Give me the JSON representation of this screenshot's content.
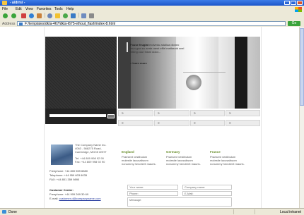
{
  "window": {
    "title": "- a/drrsi -",
    "brand_colors": {
      "title_bar": "#2a66d9",
      "accent_green": "#6a8f2e"
    }
  },
  "menu": [
    "File",
    "Edit",
    "View",
    "Favorites",
    "Tools",
    "Help"
  ],
  "toolbar": {
    "icons": [
      "back-icon",
      "forward-icon",
      "stop-icon",
      "refresh-icon",
      "home-icon",
      "search-icon",
      "favorites-icon",
      "media-icon",
      "history-icon",
      "mail-icon",
      "print-icon"
    ]
  },
  "address": {
    "label": "Address",
    "value": "F:/templates/dkta-467/dkta-t675-ethout_flash/index-8.html",
    "go": "Go"
  },
  "hero": {
    "text_bold": "Fouse feugiat",
    "text": "molvedu adallua dioneo mun gue eu aerte ment effirf metheotd snel letting cour lhioni dolor...",
    "learn_more": "» learn more"
  },
  "tabs": [
    "»",
    "»",
    "»",
    "»",
    "»",
    "»",
    "»",
    "»"
  ],
  "company": {
    "lines": [
      "The Company Name Inc.",
      "4063 - 568275 Road,",
      "Cambridge, MGX5 8HHT",
      "",
      "Tel: +44 809 998 92 90",
      "Fax: +44 809 998 92 90"
    ]
  },
  "phones": [
    "Freephone:  +44 800 559 6580",
    "Telephone:  +44 959 603 6035",
    "FAX:          +44 801 359 9890"
  ],
  "customer_center": {
    "heading": "Customer Center:",
    "freephone": "Freephone:  +44 909 269 30 69",
    "email_label": "E-mail:",
    "email": "customer-d@companyname.com"
  },
  "offices": [
    {
      "name": "England",
      "text": "Praesent vestibulum molestie lacusaliwom nonummy hendrerit mauris."
    },
    {
      "name": "Germany",
      "text": "Praesent vestibulum molestie lacusaliwom nonummy hendrerit mauris."
    },
    {
      "name": "France",
      "text": "Praesent vestibulum molestie lacusaliwom nonummy hendrerit mauris."
    }
  ],
  "form": {
    "your_name": "Your name:",
    "company_name": "Company name:",
    "phone": "Phone:",
    "email": "E-Mail:",
    "message": "Message:"
  },
  "status": {
    "left": "Done",
    "right": "Local intranet"
  }
}
